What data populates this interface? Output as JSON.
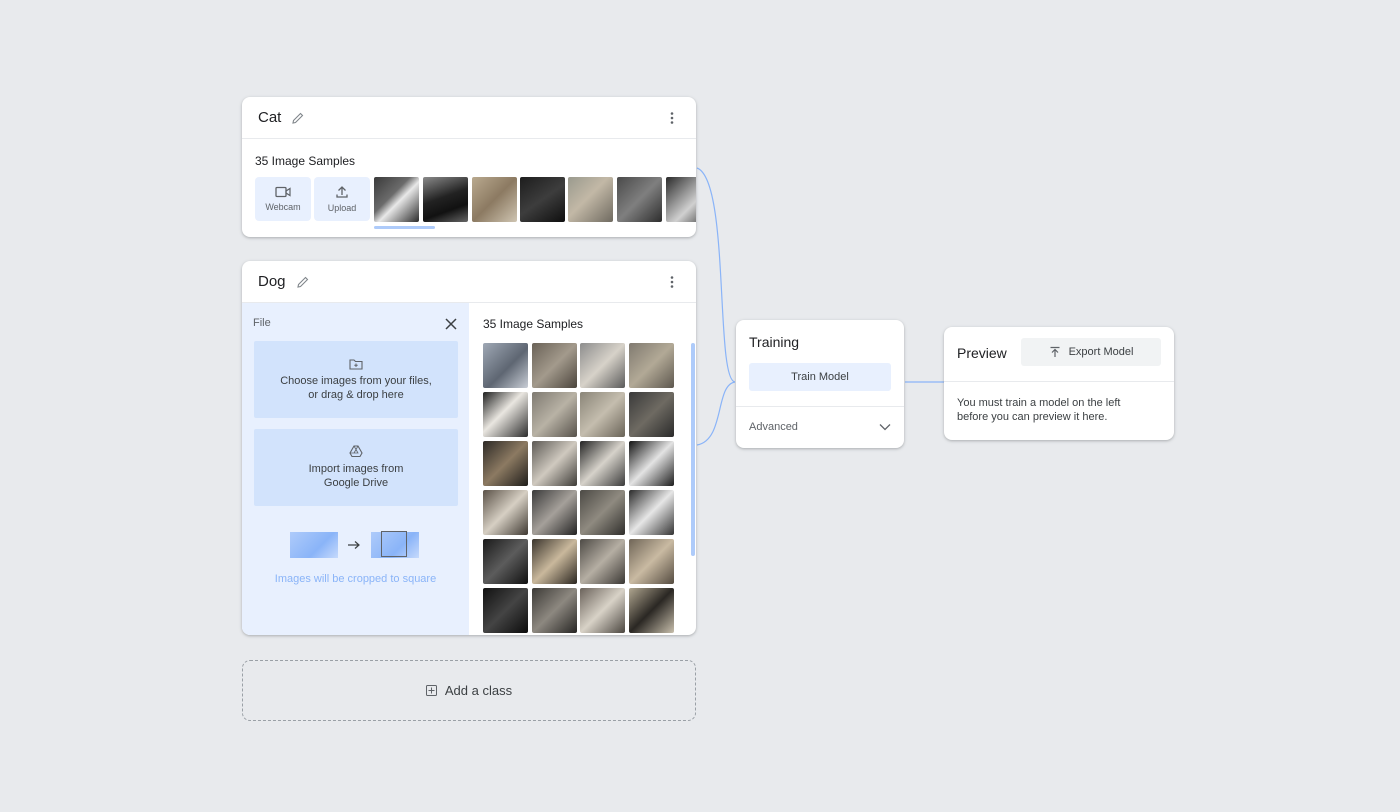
{
  "cat_class": {
    "name": "Cat",
    "samples_label": "35 Image Samples",
    "webcam_label": "Webcam",
    "upload_label": "Upload"
  },
  "dog_class": {
    "name": "Dog",
    "file_label": "File",
    "choose_text_1": "Choose images from your files,",
    "choose_text_2": "or drag & drop here",
    "drive_text_1": "Import images from",
    "drive_text_2": "Google Drive",
    "crop_note": "Images will be cropped to square",
    "samples_label": "35 Image Samples"
  },
  "add_class": {
    "label": "Add a class"
  },
  "training": {
    "title": "Training",
    "train_button": "Train Model",
    "advanced_label": "Advanced"
  },
  "preview": {
    "title": "Preview",
    "export_button": "Export Model",
    "message_1": "You must train a model on the left",
    "message_2": "before you can preview it here."
  },
  "colors": {
    "background": "#e8eaed",
    "accent": "#1a73e8",
    "light_blue": "#e8f0fe",
    "panel_blue": "#d2e3fc"
  },
  "icons": [
    "pencil-icon",
    "more-vert-icon",
    "webcam-icon",
    "upload-icon",
    "close-icon",
    "folder-icon",
    "drive-icon",
    "chevron-down-icon",
    "export-icon",
    "add-box-icon",
    "arrow-right-icon"
  ]
}
